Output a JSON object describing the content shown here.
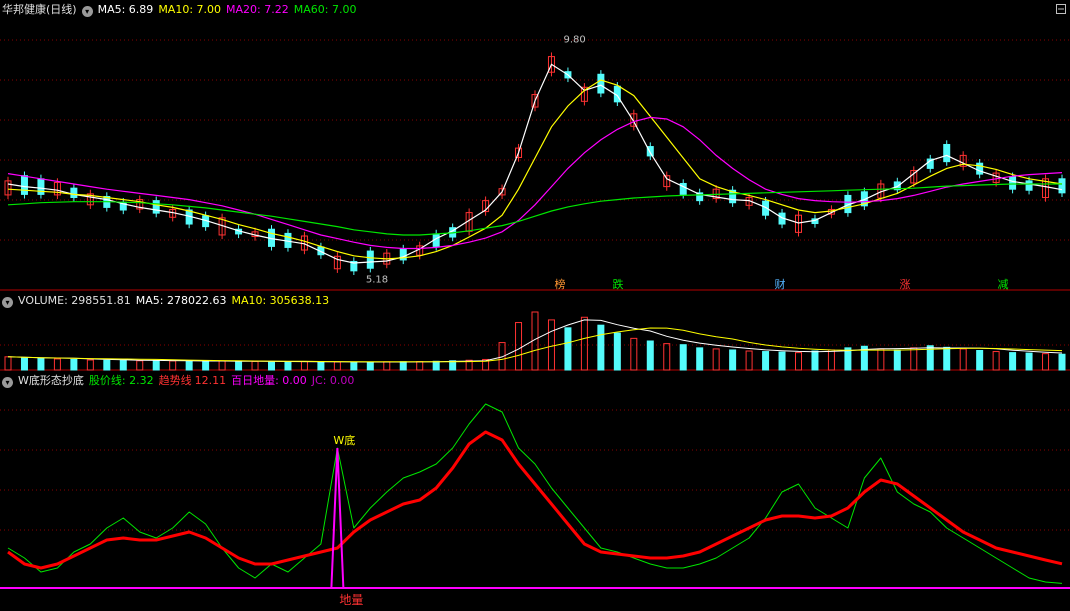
{
  "main": {
    "title": "华邦健康(日线)",
    "ma5": "MA5: 6.89",
    "ma10": "MA10: 7.00",
    "ma20": "MA20: 7.22",
    "ma60": "MA60: 7.00",
    "high_label": "9.80",
    "low_label": "5.18",
    "tags": [
      "榜",
      "跌",
      "财",
      "涨",
      "减"
    ]
  },
  "volume": {
    "label": "VOLUME: 298551.81",
    "ma5": "MA5: 278022.63",
    "ma10": "MA10: 305638.13"
  },
  "indicator": {
    "name": "W底形态抄底",
    "price_line": "股价线: 2.32",
    "trend_line": "趋势线",
    "trend_value": "12.11",
    "ground": "百日地量: 0.00",
    "jc": "JC: 0.00",
    "w_label": "W底",
    "ground_label": "地量"
  },
  "colors": {
    "up": "#ff3232",
    "down": "#54fcfc",
    "ma5": "#ffffff",
    "ma10": "#ffff00",
    "ma20": "#ff00ff",
    "ma60": "#00e600",
    "grid": "#8b0000"
  },
  "chart_data": [
    {
      "type": "candlestick",
      "series": [
        {
          "name": "MA5",
          "values": [
            7.0,
            6.95,
            6.92,
            6.88,
            6.8,
            6.75,
            6.7,
            6.62,
            6.55,
            6.5,
            6.45,
            6.38,
            6.3,
            6.2,
            6.1,
            6.02,
            5.95,
            5.9,
            5.85,
            5.7,
            5.55,
            5.48,
            5.5,
            5.52,
            5.6,
            5.75,
            5.95,
            6.1,
            6.3,
            6.5,
            6.85,
            7.6,
            8.6,
            9.3,
            9.1,
            8.8,
            8.9,
            8.7,
            8.2,
            7.6,
            7.1,
            6.95,
            6.8,
            6.75,
            6.7,
            6.68,
            6.55,
            6.35,
            6.25,
            6.3,
            6.45,
            6.6,
            6.7,
            6.85,
            6.95,
            7.2,
            7.45,
            7.55,
            7.4,
            7.25,
            7.15,
            7.05,
            7.0,
            6.95,
            6.89
          ]
        },
        {
          "name": "MA10",
          "values": [
            6.9,
            6.88,
            6.86,
            6.84,
            6.8,
            6.78,
            6.74,
            6.7,
            6.66,
            6.6,
            6.55,
            6.48,
            6.4,
            6.32,
            6.22,
            6.14,
            6.05,
            5.98,
            5.9,
            5.8,
            5.7,
            5.62,
            5.58,
            5.56,
            5.58,
            5.62,
            5.7,
            5.82,
            5.98,
            6.15,
            6.4,
            6.9,
            7.5,
            8.1,
            8.5,
            8.8,
            9.0,
            8.9,
            8.7,
            8.3,
            7.9,
            7.5,
            7.1,
            6.95,
            6.85,
            6.78,
            6.7,
            6.6,
            6.5,
            6.45,
            6.48,
            6.55,
            6.62,
            6.72,
            6.82,
            6.98,
            7.15,
            7.3,
            7.38,
            7.35,
            7.28,
            7.18,
            7.1,
            7.05,
            7.0
          ]
        },
        {
          "name": "MA20",
          "values": [
            7.2,
            7.15,
            7.1,
            7.05,
            7.0,
            6.95,
            6.9,
            6.86,
            6.82,
            6.78,
            6.74,
            6.7,
            6.64,
            6.58,
            6.5,
            6.42,
            6.32,
            6.22,
            6.12,
            6.02,
            5.95,
            5.88,
            5.82,
            5.78,
            5.76,
            5.76,
            5.78,
            5.82,
            5.88,
            5.96,
            6.08,
            6.3,
            6.6,
            6.95,
            7.3,
            7.6,
            7.85,
            8.05,
            8.2,
            8.28,
            8.25,
            8.1,
            7.85,
            7.55,
            7.3,
            7.08,
            6.9,
            6.8,
            6.72,
            6.68,
            6.66,
            6.65,
            6.66,
            6.68,
            6.72,
            6.78,
            6.86,
            6.94,
            7.0,
            7.05,
            7.1,
            7.15,
            7.18,
            7.2,
            7.22
          ]
        },
        {
          "name": "MA60",
          "values": [
            6.6,
            6.62,
            6.64,
            6.65,
            6.66,
            6.66,
            6.66,
            6.65,
            6.64,
            6.62,
            6.6,
            6.57,
            6.54,
            6.5,
            6.46,
            6.42,
            6.38,
            6.33,
            6.28,
            6.23,
            6.18,
            6.12,
            6.08,
            6.04,
            6.02,
            6.02,
            6.04,
            6.06,
            6.1,
            6.15,
            6.2,
            6.28,
            6.38,
            6.48,
            6.56,
            6.62,
            6.67,
            6.7,
            6.73,
            6.75,
            6.77,
            6.78,
            6.79,
            6.8,
            6.81,
            6.82,
            6.83,
            6.84,
            6.85,
            6.86,
            6.87,
            6.88,
            6.89,
            6.9,
            6.91,
            6.92,
            6.94,
            6.96,
            6.97,
            6.98,
            6.99,
            7.0,
            7.0,
            7.0,
            7.0
          ]
        }
      ],
      "y_range": [
        5.0,
        10.0
      ],
      "notes": [
        "9.80",
        "5.18"
      ]
    },
    {
      "type": "bar",
      "series": [
        {
          "name": "VOLUME",
          "values": [
            250000,
            230000,
            220000,
            210000,
            200000,
            190000,
            185000,
            180000,
            175000,
            178000,
            172000,
            168000,
            165000,
            170000,
            160000,
            162000,
            158000,
            155000,
            160000,
            150000,
            152000,
            148000,
            150000,
            155000,
            158000,
            160000,
            165000,
            175000,
            185000,
            200000,
            520000,
            900000,
            1100000,
            950000,
            800000,
            1000000,
            850000,
            700000,
            600000,
            550000,
            500000,
            480000,
            420000,
            400000,
            380000,
            360000,
            350000,
            340000,
            330000,
            360000,
            380000,
            420000,
            450000,
            400000,
            380000,
            420000,
            460000,
            430000,
            400000,
            370000,
            350000,
            330000,
            320000,
            310000,
            298551
          ]
        }
      ]
    },
    {
      "type": "line",
      "series": [
        {
          "name": "股价线",
          "values": [
            20,
            15,
            8,
            10,
            18,
            22,
            30,
            35,
            28,
            25,
            30,
            38,
            32,
            20,
            10,
            5,
            12,
            8,
            15,
            22,
            70,
            30,
            40,
            48,
            55,
            58,
            62,
            70,
            82,
            92,
            88,
            70,
            62,
            50,
            40,
            30,
            20,
            18,
            15,
            12,
            10,
            10,
            12,
            15,
            20,
            25,
            35,
            48,
            52,
            40,
            35,
            30,
            55,
            65,
            48,
            42,
            38,
            30,
            25,
            20,
            15,
            10,
            5,
            3,
            2.32
          ]
        },
        {
          "name": "趋势线",
          "values": [
            18,
            12,
            10,
            12,
            16,
            20,
            24,
            25,
            24,
            24,
            26,
            28,
            25,
            20,
            15,
            12,
            12,
            14,
            16,
            18,
            20,
            28,
            34,
            38,
            42,
            44,
            50,
            60,
            72,
            78,
            74,
            62,
            52,
            42,
            32,
            22,
            18,
            17,
            16,
            15,
            15,
            16,
            18,
            22,
            26,
            30,
            34,
            36,
            36,
            35,
            36,
            40,
            48,
            54,
            52,
            46,
            40,
            34,
            28,
            24,
            20,
            18,
            16,
            14,
            12.11
          ]
        }
      ],
      "y_range": [
        -10,
        100
      ]
    }
  ]
}
